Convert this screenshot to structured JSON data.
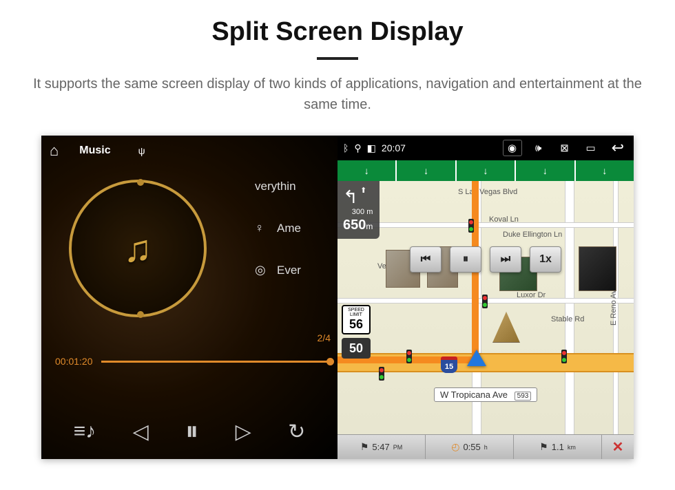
{
  "page": {
    "title": "Split Screen Display",
    "subtitle": "It supports the same screen display of two kinds of applications, navigation and entertainment at the same time."
  },
  "music": {
    "top": {
      "app_label": "Music",
      "source": "USB"
    },
    "tracks": {
      "row1": "verythin",
      "row2": "Ame",
      "row3": "Ever"
    },
    "index": "2/4",
    "time_elapsed": "00:01:20",
    "controls": {
      "playlist": "≡♪",
      "prev": "◁",
      "pause": "⏸",
      "next": "▷",
      "repeat": "↻"
    }
  },
  "status": {
    "clock": "20:07"
  },
  "nav": {
    "turn": {
      "dist_small": "300 m",
      "dist_big": "650",
      "unit": "m"
    },
    "streets": {
      "s_las_vegas": "S Las Vegas Blvd",
      "koval": "Koval Ln",
      "duke": "Duke Ellington Ln",
      "vegas_blvd": "Vegas Blvd",
      "luxor": "Luxor Dr",
      "stable": "Stable Rd",
      "reno": "E Reno Ave",
      "tropicana": "W Tropicana Ave",
      "pin": "593"
    },
    "media_overlay": {
      "prev": "⏮",
      "pause": "⏸",
      "next": "⏭",
      "speed": "1x"
    },
    "speed_limit": {
      "label_top": "SPEED",
      "label_bot": "LIMIT",
      "value": "56"
    },
    "current_speed": "50",
    "shield": "15",
    "footer": {
      "eta": "5:47",
      "eta_suffix": "PM",
      "duration": "0:55",
      "duration_suffix": "h",
      "distance": "1.1",
      "distance_unit": "km"
    }
  }
}
